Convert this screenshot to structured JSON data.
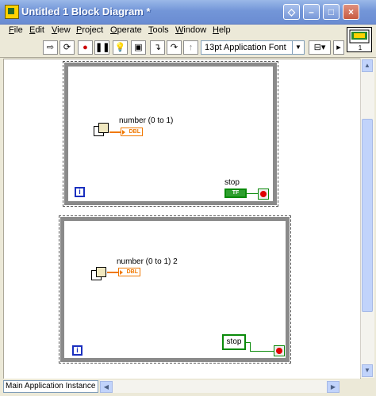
{
  "window": {
    "title": "Untitled 1 Block Diagram *"
  },
  "title_buttons": {
    "run_glyph": "◇",
    "minimize": "–",
    "maximize": "□",
    "close": "×"
  },
  "menu": [
    {
      "hot": "F",
      "rest": "ile"
    },
    {
      "hot": "E",
      "rest": "dit"
    },
    {
      "hot": "V",
      "rest": "iew"
    },
    {
      "hot": "P",
      "rest": "roject"
    },
    {
      "hot": "O",
      "rest": "perate"
    },
    {
      "hot": "T",
      "rest": "ools"
    },
    {
      "hot": "W",
      "rest": "indow"
    },
    {
      "hot": "H",
      "rest": "elp"
    }
  ],
  "toolbar": {
    "font_value": "13pt Application Font",
    "icons": [
      "run-arrow-icon",
      "run-continuously-icon",
      "abort-icon",
      "pause-icon",
      "highlight-execution-icon",
      "retain-wire-values-icon",
      "step-into-icon",
      "step-over-icon",
      "step-out-icon",
      "align-icon",
      "distribute-icon"
    ]
  },
  "context_icon": {
    "number": "1"
  },
  "loops": [
    {
      "random_label": "number (0 to 1)",
      "dbl_text": "DBL",
      "stop_label": "stop",
      "stop_kind": "tf",
      "stop_text": "TF",
      "iteration_symbol": "i"
    },
    {
      "random_label": "number (0 to 1) 2",
      "dbl_text": "DBL",
      "stop_label": "",
      "stop_kind": "control",
      "stop_text": "stop",
      "iteration_symbol": "i"
    }
  ],
  "statusbar": {
    "context": "Main Application Instance"
  }
}
